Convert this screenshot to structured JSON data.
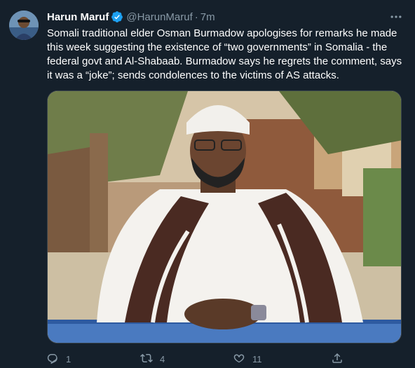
{
  "tweet": {
    "author_name": "Harun Maruf",
    "handle": "@HarunMaruf",
    "separator": "·",
    "time": "7m",
    "text": "Somali traditional elder Osman Burmadow apologises for remarks he made this week suggesting the existence of “two governments” in Somalia - the federal govt and Al-Shabaab. Burmadow says he regrets the comment, says it was a “joke”; sends condolences to the victims of AS attacks.",
    "media": {
      "image_description": ""
    },
    "actions": {
      "reply_count": "1",
      "retweet_count": "4",
      "like_count": "11"
    }
  },
  "colors": {
    "background": "#15202b",
    "text_primary": "#ffffff",
    "text_secondary": "#8899a6",
    "verified_badge": "#1da1f2",
    "border": "#38444d"
  },
  "icons": {
    "verified": "verified-badge-icon",
    "more": "more-options-icon",
    "reply": "reply-icon",
    "retweet": "retweet-icon",
    "like": "like-heart-icon",
    "share": "share-icon"
  }
}
